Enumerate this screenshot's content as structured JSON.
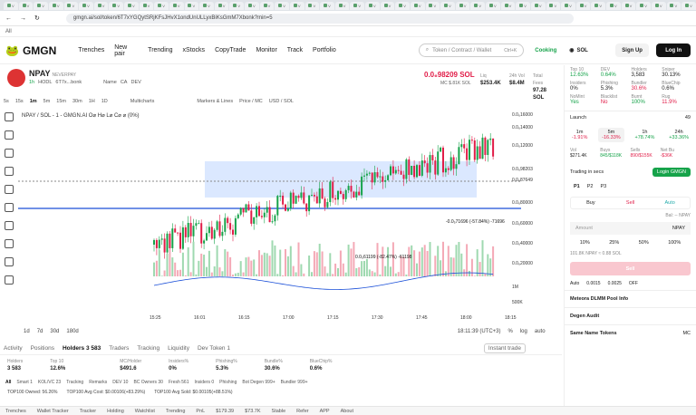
{
  "browser": {
    "url": "gmgn.ai/sol/token/6T7xYGQytSRjKFsJHvX1ondUnULLyxBiKsGmM7Xbonk?min=5",
    "bookmark": "All"
  },
  "nav": {
    "logo": "GMGN",
    "items": [
      "Trenches",
      "New pair",
      "Trending",
      "xStocks",
      "CopyTrade",
      "Monitor",
      "Track",
      "Portfolio"
    ],
    "search_placeholder": "Token / Contract / Wallet",
    "search_shortcut": "Ctrl+K",
    "cooking": "Cooking",
    "chain": "SOL",
    "signup": "Sign Up",
    "login": "Log In"
  },
  "token": {
    "symbol": "NPAY",
    "fullname": "NEVERPAY",
    "age": "1h",
    "holder_tag": "HODL",
    "address": "6T7x...bonk",
    "name_label": "Name",
    "ca_label": "CA",
    "dev_label": "DEV",
    "price": "0.0₆98209 SOL",
    "mc_label": "MC",
    "mc": "$.81K SOL",
    "liq_label": "Liq",
    "liq": "$253.4K",
    "vol_label": "24h Vol",
    "vol": "$8.4M",
    "fees_label": "Total Fees",
    "fees": "97.28 SOL"
  },
  "chart_tools": {
    "intervals": [
      "5s",
      "15s",
      "1m",
      "5m",
      "15m",
      "30m",
      "1H",
      "1D"
    ],
    "multicharts": "Multicharts",
    "markers": "Markers & Lines",
    "price": "Price / MC",
    "quote": "USD / SOL"
  },
  "chart_header": "NPAY / SOL - 1 - GMGN.AI  O⌀ H⌀ L⌀ C⌀  ⌀ (0%)",
  "chart_data": {
    "type": "candlestick",
    "yaxis": [
      "0.0₆16000",
      "0.0₆14000",
      "0.0₆12000",
      "0.0₆98203",
      "0.0₆87649",
      "0.0₆80000",
      "0.0₆60000",
      "0.0₆40000",
      "0.0₆20000",
      "1M",
      "500K"
    ],
    "xaxis": [
      "15:25",
      "16:01",
      "16:15",
      "17:00",
      "17:15",
      "17:30",
      "17:45",
      "18:00",
      "18:15"
    ],
    "annotations": [
      "-0.0₅71696 (-57.84%) -71696",
      "0.0₅61199 (-82.47%) -61198"
    ]
  },
  "chart_footer": {
    "ranges": [
      "1d",
      "7d",
      "30d",
      "180d"
    ],
    "time": "18:11:39 (UTC+3)",
    "scale": [
      "%",
      "log",
      "auto"
    ]
  },
  "tabs": [
    "Activity",
    "Positions",
    "Holders 3 583",
    "Traders",
    "Tracking",
    "Liquidity",
    "Dev Token 1"
  ],
  "instant": "Instant trade",
  "holders_stats": [
    {
      "label": "Holders",
      "value": "3 583"
    },
    {
      "label": "Top 10",
      "value": "12.6%"
    },
    {
      "label": "MC/Holder",
      "value": "$491.6"
    },
    {
      "label": "Insiders%",
      "value": "0%"
    },
    {
      "label": "Phishing%",
      "value": "5.3%"
    },
    {
      "label": "Bundle%",
      "value": "30.6%"
    },
    {
      "label": "BlueChip%",
      "value": "0.6%"
    }
  ],
  "filters": [
    "All",
    "Smart 1",
    "KOL/VC 23",
    "Tracking",
    "Remarks",
    "DEV 10",
    "BC Owners 30",
    "Fresh 561",
    "Insiders 0",
    "Phishing",
    "Bot Degen 999+",
    "Bundler 999+"
  ],
  "summary": [
    "TOP100 Owned: 56.26%",
    "TOP100 Avg Cost: $0.00106(+83.29%)",
    "TOP100 Avg Sold: $0.00105(+88.51%)"
  ],
  "panel": {
    "stats": [
      {
        "label": "Top 10",
        "value": "12.63%"
      },
      {
        "label": "DEV",
        "value": "0.64%"
      },
      {
        "label": "Holders",
        "value": "3,583"
      },
      {
        "label": "Sniper",
        "value": "30.13%"
      },
      {
        "label": "Insiders",
        "value": "0%"
      },
      {
        "label": "Phishing",
        "value": "5.3%"
      },
      {
        "label": "Bundler",
        "value": "30.6%"
      },
      {
        "label": "BlueChip",
        "value": "0.6%"
      },
      {
        "label": "NoMint",
        "value": "Yes"
      },
      {
        "label": "Blacklist",
        "value": "No"
      },
      {
        "label": "Burnt",
        "value": "100%"
      },
      {
        "label": "Rug",
        "value": "11.9%"
      }
    ],
    "launch": "Launch",
    "launch_count": "49",
    "tf": [
      {
        "k": "1m",
        "v": "-1.91%"
      },
      {
        "k": "5m",
        "v": "-16.33%"
      },
      {
        "k": "1h",
        "v": "+78.74%"
      },
      {
        "k": "24h",
        "v": "+33.36%"
      }
    ],
    "vol": [
      {
        "label": "Vol",
        "value": "$271.4K"
      },
      {
        "label": "Buys",
        "value": "845/$118K"
      },
      {
        "label": "Sells",
        "value": "890/$155K"
      },
      {
        "label": "Net Bu",
        "value": "-$36K"
      }
    ],
    "trading_secs": "Trading in secs",
    "login_gmgn": "Login GMGN",
    "presets": [
      "P1",
      "P2",
      "P3"
    ],
    "buy": "Buy",
    "sell": "Sell",
    "auto": "Auto",
    "balance": "Bal: -- NPAY",
    "amount": "Amount",
    "unit": "NPAY",
    "pcts": [
      "10%",
      "25%",
      "50%",
      "100%"
    ],
    "est": "101.8K NPAY ≈ 0.88 SOL",
    "sell_btn": "Sell",
    "auto_label": "Auto",
    "fee1": "0.0015",
    "fee2": "0.0025",
    "off": "OFF",
    "pool": "Meteora DLMM Pool Info",
    "audit": "Degen Audit",
    "same": "Same Name Tokens",
    "mc": "MC"
  },
  "footer": [
    "Trenches",
    "Wallet Tracker",
    "Tracker",
    "Holding",
    "Watchlist",
    "Trending",
    "PnL",
    "$179.39",
    "$73.7K",
    "Stable",
    "Refer",
    "APP",
    "About"
  ]
}
